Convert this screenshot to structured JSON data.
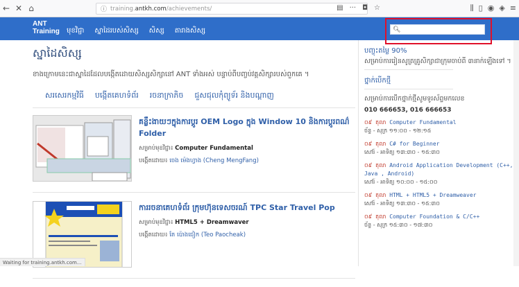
{
  "browser": {
    "url_prefix": "training.",
    "url_host": "antkh.com",
    "url_path": "/achievements/"
  },
  "site": {
    "brand_line1": "ANT",
    "brand_line2": "Training",
    "menu": [
      "មុខវិជ្ជា",
      "ស្នាដៃរបស់សិស្ស",
      "សិស្ស",
      "តារាងសិស្ស"
    ],
    "search_placeholder": ""
  },
  "main": {
    "page_title": "ស្នាដៃសិស្ស",
    "description": "ខាងក្រោមនេះជាស្នាដៃដែលបង្កើតដោយសិស្សសិក្សានៅ ANT ទាំងអស់ បន្ទាប់ពីបញ្ចប់វគ្គសិក្សារបស់ពួកគេ ។",
    "categories": [
      "សរសេរកម្មវិធី",
      "បង្កើតគេហទំព័រ",
      "រចនាក្រាភិច",
      "ជួសជុលកុំព្យូទ័រ និងបណ្តាញ"
    ],
    "articles": [
      {
        "title": "គន្លឹះងាយៗក្នុងការប្តូរ OEM Logo ក្នុង Window 10 និងការប្តូរពណ៌ Folder",
        "subject_label": "សម្រាប់មុខវិជ្ជា៖",
        "subject": "Computer Fundamental",
        "by_label": "បង្កើតដោយ៖",
        "author": "ចេង ម៉េងហ្វាង (Cheng MengFang)"
      },
      {
        "title": "ការរចនាគេហទំព័រ ក្រុមហ៊ុនទេសចរណ៍ TPC Star Travel Pop",
        "subject_label": "សម្រាប់មុខវិជ្ជា៖",
        "subject": "HTML5 + Dreamwaver",
        "by_label": "បង្កើតដោយ៖",
        "author": "តែ ប៉ោងជៀក (Teo Paocheak)"
      }
    ]
  },
  "sidebar": {
    "discount_title": "បញ្ចុះតម្លៃ 90%",
    "discount_text": "សម្រាប់ការរៀនសូត្រគ្រូសិក្សាជាក្រុមចាប់ពី ៣នាក់ឡើងទៅ ។",
    "new_class_title": "ថ្នាក់បើកថ្មី",
    "new_class_text": "សម្រាប់ការបើកថ្នាក់ថ្មីសូមទូរស័ព្ទមកលេខ",
    "phone": "010 666653, 016 666653",
    "schedule": [
      {
        "date": "០៩ តុលា",
        "course": "Computer Fundamental",
        "time": "ច័ន្ទ - សុក្រ ១១:០០ - ១២:១៥"
      },
      {
        "date": "០៩ តុលា",
        "course": "C# for Beginner",
        "time": "សៅរ៍ - អាទិត្យ ១៣:៣០ - ១៥:៣០"
      },
      {
        "date": "០៩ តុលា",
        "course": "Android Application Development (C++, Java , Android)",
        "time": "សៅរ៍ - អាទិត្យ ១០:០០ - ១៥:០០"
      },
      {
        "date": "០៩ តុលា",
        "course": "HTML + HTML5 + Dreamweaver",
        "time": "សៅរ៍ - អាទិត្យ ១៣:៣០ - ១៥:៣០"
      },
      {
        "date": "០៩ តុលា",
        "course": "Computer Foundation & C/C++",
        "time": "ច័ន្ទ - សុក្រ ១៥:៣០ - ១៧:៣០"
      }
    ]
  },
  "status_text": "Waiting for training.antkh.com..."
}
